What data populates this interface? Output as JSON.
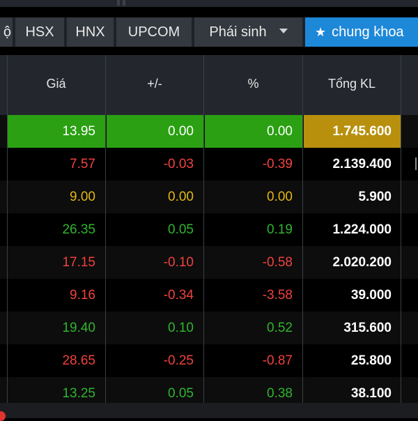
{
  "tabs": [
    {
      "label": "ộ",
      "active": false
    },
    {
      "label": "HSX",
      "active": false
    },
    {
      "label": "HNX",
      "active": false
    },
    {
      "label": "UPCOM",
      "active": false
    },
    {
      "label": "Phái sinh",
      "active": false,
      "dropdown": true
    },
    {
      "label": "chung khoa",
      "active": true,
      "icon": "star-icon"
    }
  ],
  "columns": {
    "price": "Giá",
    "change": "+/-",
    "percent": "%",
    "total_volume": "Tổng KL"
  },
  "rows": [
    {
      "price": "13.95",
      "change": "0.00",
      "percent": "0.00",
      "volume": "1.745.600",
      "trend": "highlight"
    },
    {
      "price": "7.57",
      "change": "-0.03",
      "percent": "-0.39",
      "volume": "2.139.400",
      "trend": "down"
    },
    {
      "price": "9.00",
      "change": "0.00",
      "percent": "0.00",
      "volume": "5.900",
      "trend": "ref"
    },
    {
      "price": "26.35",
      "change": "0.05",
      "percent": "0.19",
      "volume": "1.224.000",
      "trend": "up"
    },
    {
      "price": "17.15",
      "change": "-0.10",
      "percent": "-0.58",
      "volume": "2.020.200",
      "trend": "down"
    },
    {
      "price": "9.16",
      "change": "-0.34",
      "percent": "-3.58",
      "volume": "39.000",
      "trend": "down"
    },
    {
      "price": "19.40",
      "change": "0.10",
      "percent": "0.52",
      "volume": "315.600",
      "trend": "up"
    },
    {
      "price": "28.65",
      "change": "-0.25",
      "percent": "-0.87",
      "volume": "25.800",
      "trend": "down"
    },
    {
      "price": "13.25",
      "change": "0.05",
      "percent": "0.38",
      "volume": "38.100",
      "trend": "up"
    }
  ],
  "colors": {
    "up": "#2fb52d",
    "down": "#f0423e",
    "reference": "#e2b812",
    "highlight_green": "#2aa012",
    "highlight_gold": "#b8900e",
    "active_tab": "#1e88d8"
  }
}
